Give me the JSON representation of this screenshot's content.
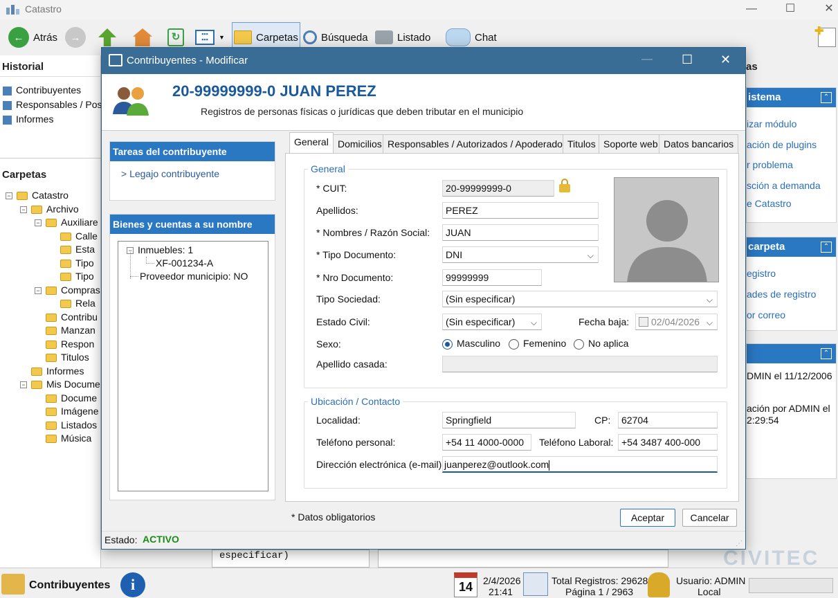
{
  "app": {
    "title": "Catastro",
    "toolbar": {
      "back": "Atrás",
      "carpetas": "Carpetas",
      "busqueda": "Búsqueda",
      "listado": "Listado",
      "chat": "Chat"
    }
  },
  "left": {
    "historial_title": "Historial",
    "historial": [
      "Contribuyentes",
      "Responsables / Pose",
      "Informes"
    ],
    "carpetas_title": "Carpetas",
    "tree": [
      {
        "label": "Catastro",
        "depth": 0,
        "expander": "−"
      },
      {
        "label": "Archivo",
        "depth": 1,
        "expander": "−"
      },
      {
        "label": "Auxiliare",
        "depth": 2,
        "expander": "−"
      },
      {
        "label": "Calle",
        "depth": 3
      },
      {
        "label": "Esta",
        "depth": 3
      },
      {
        "label": "Tipo",
        "depth": 3
      },
      {
        "label": "Tipo",
        "depth": 3
      },
      {
        "label": "Compras",
        "depth": 2,
        "expander": "−"
      },
      {
        "label": "Rela",
        "depth": 3
      },
      {
        "label": "Contribu",
        "depth": 2
      },
      {
        "label": "Manzan",
        "depth": 2
      },
      {
        "label": "Respon",
        "depth": 2
      },
      {
        "label": "Titulos",
        "depth": 2
      },
      {
        "label": "Informes",
        "depth": 1
      },
      {
        "label": "Mis Docume",
        "depth": 1,
        "expander": "−"
      },
      {
        "label": "Docume",
        "depth": 2
      },
      {
        "label": "Imágene",
        "depth": 2
      },
      {
        "label": "Listados",
        "depth": 2
      },
      {
        "label": "Música",
        "depth": 2
      }
    ]
  },
  "right": {
    "top_partial": "as",
    "sistema_title": "istema",
    "sistema_links": [
      "izar módulo",
      "ación de plugins",
      "r problema",
      "sción a demanda",
      "e Catastro"
    ],
    "carpeta_title": "carpeta",
    "carpeta_links": [
      "egistro",
      "ades de registro",
      "or correo"
    ],
    "info_lines": [
      "DMIN el 11/12/2006",
      "ación por ADMIN el",
      "2:29:54"
    ]
  },
  "statusbar": {
    "module": "Contribuyentes",
    "date": "2/4/2026",
    "time": "21:41",
    "calendar_day": "14",
    "total": "Total Registros: 29628",
    "page": "Página 1 / 2963",
    "user": "Usuario: ADMIN",
    "location": "Local",
    "behind_text": "especificar)",
    "brand": "CIVITEC"
  },
  "dialog": {
    "title": "Contribuyentes - Modificar",
    "name": "20-99999999-0 JUAN PEREZ",
    "subtitle": "Registros de personas físicas o jurídicas que deben tributar en el municipio",
    "tareas_title": "Tareas del contribuyente",
    "tareas_link": "> Legajo contribuyente",
    "bienes_title": "Bienes y cuentas a su nombre",
    "bienes_tree": {
      "inmuebles": "Inmuebles: 1",
      "partida": "XF-001234-A",
      "proveedor": "Proveedor municipio: NO"
    },
    "tabs": [
      "General",
      "Domicilios",
      "Responsables / Autorizados / Apoderados",
      "Titulos",
      "Soporte web",
      "Datos bancarios"
    ],
    "general_group": "General",
    "contacto_group": "Ubicación / Contacto",
    "labels": {
      "cuit": "* CUIT:",
      "apellidos": "Apellidos:",
      "nombres": "* Nombres / Razón Social:",
      "tipo_doc": "* Tipo Documento:",
      "nro_doc": "* Nro Documento:",
      "tipo_soc": "Tipo Sociedad:",
      "estado_civil": "Estado Civil:",
      "fecha_baja": "Fecha baja:",
      "sexo": "Sexo:",
      "apellido_casada": "Apellido casada:",
      "localidad": "Localidad:",
      "cp": "CP:",
      "tel_personal": "Teléfono personal:",
      "tel_laboral": "Teléfono Laboral:",
      "email": "Dirección electrónica (e-mail):"
    },
    "values": {
      "cuit": "20-99999999-0",
      "apellidos": "PEREZ",
      "nombres": "JUAN",
      "tipo_doc": "DNI",
      "nro_doc": "99999999",
      "tipo_soc": "(Sin especificar)",
      "estado_civil": "(Sin especificar)",
      "fecha_baja": "02/04/2026",
      "apellido_casada": "",
      "localidad": "Springfield",
      "cp": "62704",
      "tel_personal": "+54 11 4000-0000",
      "tel_laboral": "+54 3487 400-000",
      "email": "juanperez@outlook.com"
    },
    "sexo_options": [
      "Masculino",
      "Femenino",
      "No aplica"
    ],
    "sexo_selected": "Masculino",
    "required_note": "* Datos obligatorios",
    "accept": "Aceptar",
    "cancel": "Cancelar",
    "estado_label": "Estado:",
    "estado_value": "ACTIVO",
    "colors": {
      "accent": "#2a78c2",
      "title_bar": "#3a6d96",
      "name": "#1a5a9c",
      "active": "#1a8a1a"
    }
  }
}
